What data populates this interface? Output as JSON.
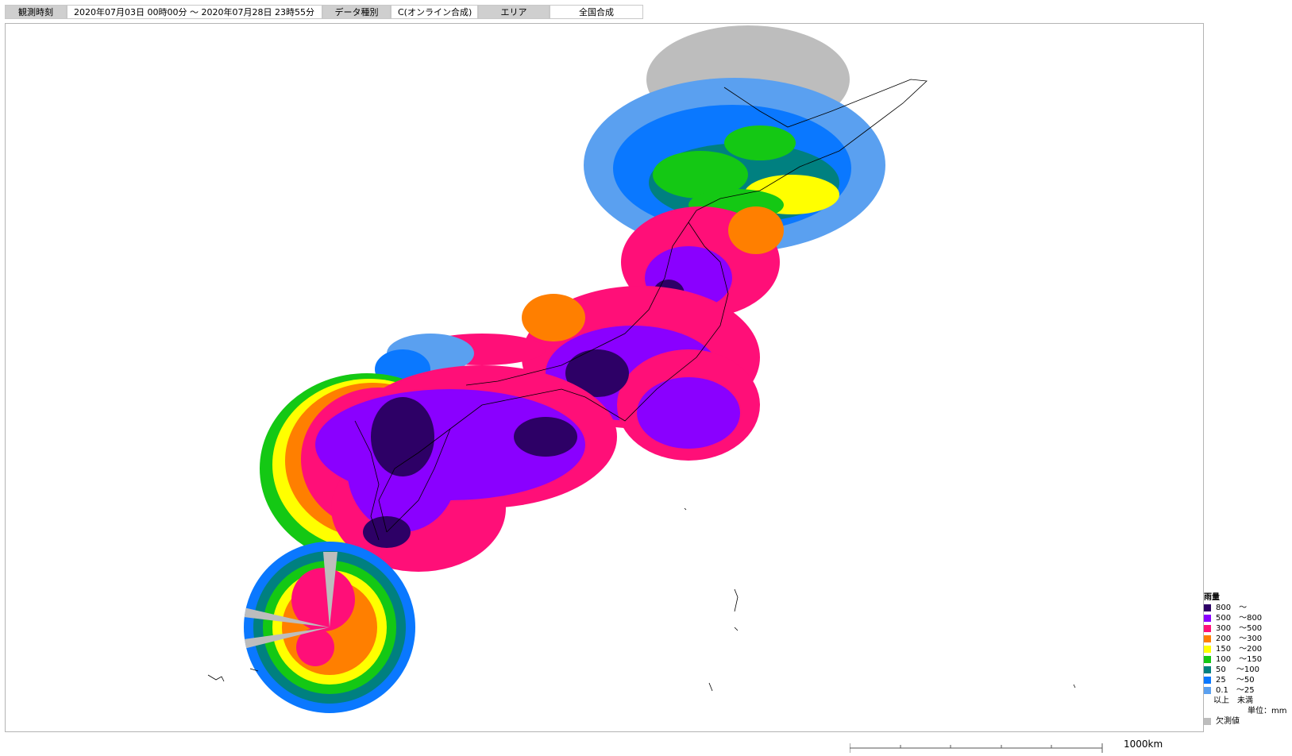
{
  "header": {
    "obs_time_label": "観測時刻",
    "obs_time_value": "2020年07月03日 00時00分 ～ 2020年07月28日 23時55分",
    "data_type_label": "データ種別",
    "data_type_value": "C(オンライン合成)",
    "area_label": "エリア",
    "area_value": "全国合成"
  },
  "legend": {
    "title": "雨量",
    "items": [
      {
        "label": "800　～",
        "color": "#2d0066"
      },
      {
        "label": "500　～800",
        "color": "#8a00ff"
      },
      {
        "label": "300　～500",
        "color": "#ff0f78"
      },
      {
        "label": "200　～300",
        "color": "#ff7f00"
      },
      {
        "label": "150　～200",
        "color": "#ffff00"
      },
      {
        "label": "100　～150",
        "color": "#14c814"
      },
      {
        "label": "50　 ～100",
        "color": "#008080"
      },
      {
        "label": "25　 ～50",
        "color": "#0a78ff"
      },
      {
        "label": "0.1　～25",
        "color": "#5aa0f0"
      }
    ],
    "footer": "以上　未満",
    "unit": "単位：mm",
    "missing_label": "欠測値",
    "missing_color": "#bdbdbd"
  },
  "scale": {
    "label": "1000km"
  }
}
